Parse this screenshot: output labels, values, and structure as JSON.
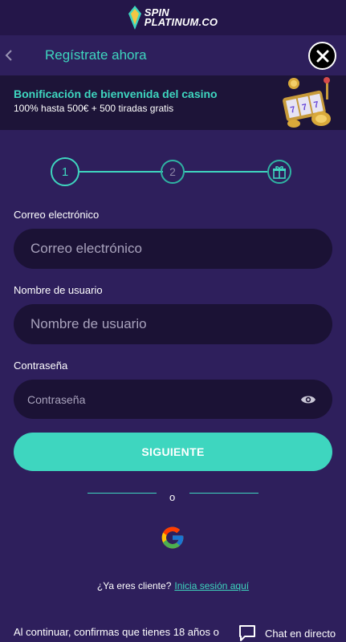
{
  "brand": {
    "line1": "SPIN",
    "line2": "PLATINUM.CO",
    "accent": "#3ed6bf"
  },
  "header": {
    "title": "Regístrate ahora",
    "back_icon": "chevron-left-icon",
    "close_icon": "close-icon"
  },
  "bonus": {
    "title": "Bonificación de bienvenida del casino",
    "subtitle": "100% hasta 500€ + 500 tiradas gratis"
  },
  "stepper": {
    "steps": [
      "1",
      "2"
    ],
    "final_icon": "gift-icon",
    "current": 1
  },
  "form": {
    "email": {
      "label": "Correo electrónico",
      "placeholder": "Correo electrónico"
    },
    "username": {
      "label": "Nombre de usuario",
      "placeholder": "Nombre de usuario"
    },
    "password": {
      "label": "Contraseña",
      "placeholder": "Contraseña",
      "toggle_icon": "eye-icon"
    },
    "submit_label": "SIGUIENTE"
  },
  "divider_text": "o",
  "social": {
    "icon": "google-icon"
  },
  "login": {
    "prompt": "¿Ya eres cliente?",
    "link": "Inicia sesión aquí"
  },
  "footer": {
    "text": "Al continuar, confirmas que tienes 18 años o"
  },
  "chat": {
    "label": "Chat en directo",
    "icon": "chat-icon"
  }
}
